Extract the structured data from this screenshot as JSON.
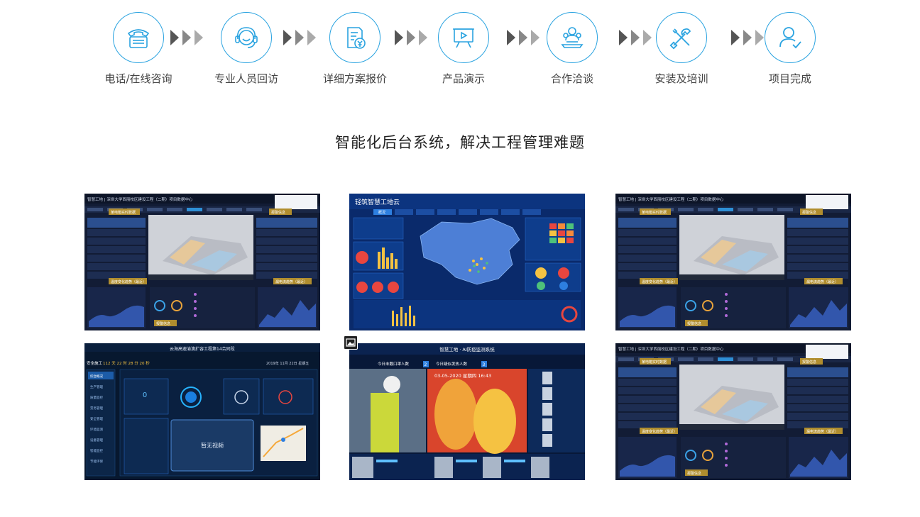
{
  "process": {
    "steps": [
      {
        "label": "电话/在线咨询",
        "icon": "telephone-icon"
      },
      {
        "label": "专业人员回访",
        "icon": "headset-icon"
      },
      {
        "label": "详细方案报价",
        "icon": "quote-document-icon"
      },
      {
        "label": "产品演示",
        "icon": "presentation-board-icon"
      },
      {
        "label": "合作洽谈",
        "icon": "meeting-icon"
      },
      {
        "label": "安装及培训",
        "icon": "tools-icon"
      },
      {
        "label": "项目完成",
        "icon": "user-check-icon"
      }
    ],
    "accent": "#2aa3e0",
    "arrow_color": "#555555"
  },
  "section": {
    "title": "智能化后台系统，解决工程管理难题"
  },
  "screenshots": [
    {
      "kind": "dashboard-3d",
      "header": "智慧工地 | 深圳大学西丽校区建设工程（二期）项目数据中心",
      "tags": [
        "某电箱实时数据",
        "报警信息",
        "温度变化趋势（最近）",
        "漏电流趋势（最近）",
        "报警信息"
      ]
    },
    {
      "kind": "map-dashboard",
      "header": "轻筑智慧工地云",
      "tab": "概况"
    },
    {
      "kind": "dashboard-3d",
      "header": "智慧工地 | 深圳大学西丽校区建设工程（二期）项目数据中心",
      "tags": [
        "某电箱实时数据",
        "报警信息",
        "温度变化趋势（最近）",
        "漏电流趋势（最近）",
        "报警信息"
      ]
    },
    {
      "kind": "video-dashboard",
      "header": "云海高速渝澳扩容工程第14合同段",
      "safety_label": "安全施工",
      "safety_days": "112 天 22 时 28 分 20 秒",
      "date": "2019年 11月 22日 星期五",
      "no_video": "暂无视频",
      "menu": [
        "综合概况",
        "生产管理",
        "质量监控",
        "劳务管理",
        "安全管理",
        "环境监测",
        "设备管理",
        "智能监控",
        "节能环保"
      ]
    },
    {
      "kind": "ai-epidemic",
      "header": "智慧工地 · AI防疫监测系统",
      "today_in": "今日未戴口罩人数",
      "today_in_value": "2",
      "today_out": "今日疑似发热人数",
      "today_out_value": "3",
      "timestamp": "03-05-2020 星期四 16:43"
    },
    {
      "kind": "dashboard-3d",
      "header": "智慧工地 | 深圳大学西丽校区建设工程（二期）项目数据中心",
      "tags": [
        "某电箱实时数据",
        "报警信息",
        "温度变化趋势（最近）",
        "漏电流趋势（最近）",
        "报警信息"
      ]
    }
  ]
}
